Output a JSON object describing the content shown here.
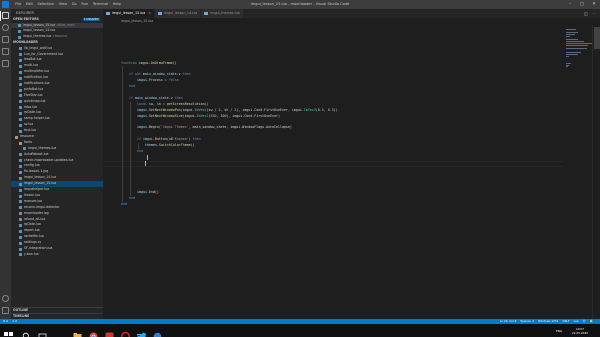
{
  "window": {
    "title": "imgui_lesson_15.lua - moonloader - Visual Studio Code",
    "menu": [
      "File",
      "Edit",
      "Selection",
      "View",
      "Go",
      "Run",
      "Terminal",
      "Help"
    ],
    "controls": [
      "–",
      "□",
      "✕"
    ]
  },
  "sidebar": {
    "title": "EXPLORER",
    "open_editors": {
      "label": "OPEN EDITORS",
      "badge": "1 UNSAVED",
      "items": [
        {
          "name": "imgui_lesson_15.lua",
          "extra": "other_mod",
          "color": "#519aba",
          "level": 1,
          "state": "selected"
        },
        {
          "name": "imgui_lesson_14.lua",
          "extra": "",
          "color": "#519aba",
          "level": 1,
          "state": ""
        },
        {
          "name": "imgui_themes.lua",
          "extra": "resource",
          "color": "#519aba",
          "level": 1,
          "state": ""
        }
      ]
    },
    "folder_label": "MOONLOADER",
    "files": [
      {
        "name": "lib_imgui_wolf.lua",
        "color": "#519aba",
        "level": 1
      },
      {
        "name": "Lua_for_Government.lua",
        "color": "#519aba",
        "level": 1
      },
      {
        "name": "lessBot.lua",
        "color": "#519aba",
        "level": 1
      },
      {
        "name": "multi.lua",
        "color": "#519aba",
        "level": 1
      },
      {
        "name": "multinotifier.lua",
        "color": "#519aba",
        "level": 1
      },
      {
        "name": "notification.lua",
        "color": "#519aba",
        "level": 1
      },
      {
        "name": "notifications.lua",
        "color": "#519aba",
        "level": 1
      },
      {
        "name": "pinfoBot.lua",
        "color": "#519aba",
        "level": 1
      },
      {
        "name": "FiveStar.lua",
        "color": "#519aba",
        "level": 1
      },
      {
        "name": "quickmap.lua",
        "color": "#519aba",
        "level": 1
      },
      {
        "name": "rkbo.lua",
        "color": "#519aba",
        "level": 1
      },
      {
        "name": "rpDate.lua",
        "color": "#519aba",
        "level": 1
      },
      {
        "name": "samp-helper.lua",
        "color": "#519aba",
        "level": 1
      },
      {
        "name": "sv.lua",
        "color": "#519aba",
        "level": 1
      },
      {
        "name": "test.lua",
        "color": "#519aba",
        "level": 1
      },
      {
        "name": "resource",
        "color": "#c09553",
        "level": 0
      },
      {
        "name": "fonts",
        "color": "#c09553",
        "level": 1
      },
      {
        "name": "imgui_themes.lua",
        "color": "#519aba",
        "level": 2
      },
      {
        "name": "AutoReboot.lua",
        "color": "#519aba",
        "level": 1
      },
      {
        "name": "check-moonloader-updates.lua",
        "color": "#519aba",
        "level": 1
      },
      {
        "name": "config.lua",
        "color": "#519aba",
        "level": 1
      },
      {
        "name": "fix-lesson-1.jpg",
        "color": "#a074c4",
        "level": 1
      },
      {
        "name": "imgui_lesson_14.lua",
        "color": "#519aba",
        "level": 1
      },
      {
        "name": "imgui_lesson_15.lua",
        "color": "#519aba",
        "level": 1,
        "state": "highlight"
      },
      {
        "name": "imputhelper.lua",
        "color": "#519aba",
        "level": 1
      },
      {
        "name": "lesson.lua",
        "color": "#519aba",
        "level": 1
      },
      {
        "name": "manuer.lua",
        "color": "#519aba",
        "level": 1
      },
      {
        "name": "reconn-imgui-detector",
        "color": "#519aba",
        "level": 1
      },
      {
        "name": "moonloader.log",
        "color": "#8a8a8a",
        "level": 1
      },
      {
        "name": "reload_all.lua",
        "color": "#519aba",
        "level": 1
      },
      {
        "name": "rpDate.lua",
        "color": "#519aba",
        "level": 1
      },
      {
        "name": "report.lua",
        "color": "#519aba",
        "level": 1
      },
      {
        "name": "rocketfix.lua",
        "color": "#519aba",
        "level": 1
      },
      {
        "name": "settings.cs",
        "color": "#519aba",
        "level": 1
      },
      {
        "name": "SF-integration.lua",
        "color": "#519aba",
        "level": 1
      },
      {
        "name": "y-box.lua",
        "color": "#519aba",
        "level": 1
      }
    ],
    "outline_label": "OUTLINE",
    "timeline_label": "TIMELINE"
  },
  "tabs": [
    {
      "label": "imgui_lesson_15.lua",
      "state": "active"
    },
    {
      "label": "imgui_lesson_14.lua",
      "state": ""
    },
    {
      "label": "imgui_themes.lua",
      "state": ""
    }
  ],
  "breadcrumb": "imgui_lesson_15.lua",
  "editor": {
    "lines": [
      {
        "row": 5,
        "indent": 0,
        "tokens": [
          [
            "kw",
            "function "
          ],
          [
            "fn",
            "imgui.OnDrawFrame"
          ],
          [
            "p",
            "()"
          ]
        ]
      },
      {
        "row": 7,
        "indent": 1,
        "tokens": [
          [
            "kw",
            "if not "
          ],
          [
            "var",
            "main_window_state"
          ],
          [
            "p",
            ".v "
          ],
          [
            "kw",
            "then"
          ]
        ]
      },
      {
        "row": 8,
        "indent": 2,
        "tokens": [
          [
            "var",
            "imgui"
          ],
          [
            "p",
            ".Process = "
          ],
          [
            "kw",
            "false"
          ]
        ]
      },
      {
        "row": 9,
        "indent": 1,
        "tokens": [
          [
            "kw",
            "end"
          ]
        ]
      },
      {
        "row": 11,
        "indent": 1,
        "tokens": [
          [
            "kw",
            "if "
          ],
          [
            "var",
            "main_window_state"
          ],
          [
            "p",
            ".v "
          ],
          [
            "kw",
            "then"
          ]
        ]
      },
      {
        "row": 12,
        "indent": 2,
        "tokens": [
          [
            "kw",
            "local "
          ],
          [
            "var",
            "sw"
          ],
          [
            "p",
            ", "
          ],
          [
            "var",
            "sh"
          ],
          [
            "p",
            " = "
          ],
          [
            "fn",
            "getScreenResolution"
          ],
          [
            "p",
            "()"
          ]
        ]
      },
      {
        "row": 13,
        "indent": 2,
        "tokens": [
          [
            "var",
            "imgui"
          ],
          [
            "p",
            "."
          ],
          [
            "fn",
            "SetNextWindowPos"
          ],
          [
            "p",
            "(imgui."
          ],
          [
            "cls",
            "ImVec2"
          ],
          [
            "p",
            "(sw / "
          ],
          [
            "num",
            "2"
          ],
          [
            "p",
            ", sh / "
          ],
          [
            "num",
            "2"
          ],
          [
            "p",
            "), imgui.Cond.FirstUseEver, imgui."
          ],
          [
            "cls",
            "ImVec2"
          ],
          [
            "p",
            "("
          ],
          [
            "num",
            "0.5"
          ],
          [
            "p",
            ", "
          ],
          [
            "num",
            "0.5"
          ],
          [
            "p",
            "))"
          ]
        ]
      },
      {
        "row": 14,
        "indent": 2,
        "tokens": [
          [
            "var",
            "imgui"
          ],
          [
            "p",
            "."
          ],
          [
            "fn",
            "SetNextWindowSize"
          ],
          [
            "p",
            "(imgui."
          ],
          [
            "cls",
            "ImVec2"
          ],
          [
            "p",
            "("
          ],
          [
            "num",
            "530"
          ],
          [
            "p",
            ", "
          ],
          [
            "num",
            "300"
          ],
          [
            "p",
            "), imgui.Cond.FirstUseEver)"
          ]
        ]
      },
      {
        "row": 16,
        "indent": 2,
        "tokens": [
          [
            "var",
            "imgui"
          ],
          [
            "p",
            "."
          ],
          [
            "fn",
            "Begin"
          ],
          [
            "p",
            "("
          ],
          [
            "str",
            "'Imgui Themes'"
          ],
          [
            "p",
            ", main_window_state, imgui.WindowFlags.AutoCollapse)"
          ]
        ]
      },
      {
        "row": 18,
        "indent": 2,
        "tokens": [
          [
            "kw",
            "if "
          ],
          [
            "var",
            "imgui"
          ],
          [
            "p",
            "."
          ],
          [
            "fn",
            "Button"
          ],
          [
            "p",
            "(u8"
          ],
          [
            "str",
            "'Кнопка'"
          ],
          [
            "p",
            ") "
          ],
          [
            "kw",
            "then"
          ]
        ]
      },
      {
        "row": 19,
        "indent": 3,
        "tokens": [
          [
            "var",
            "themes"
          ],
          [
            "p",
            "."
          ],
          [
            "fn",
            "SwitchColorTheme"
          ],
          [
            "p",
            "()"
          ]
        ]
      },
      {
        "row": 20,
        "indent": 2,
        "tokens": [
          [
            "kw",
            "end"
          ]
        ]
      },
      {
        "row": 27,
        "indent": 2,
        "tokens": [
          [
            "var",
            "imgui"
          ],
          [
            "p",
            "."
          ],
          [
            "fn",
            "End"
          ],
          [
            "p",
            "()"
          ]
        ]
      },
      {
        "row": 28,
        "indent": 1,
        "tokens": [
          [
            "kw",
            "end"
          ]
        ]
      },
      {
        "row": 29,
        "indent": 0,
        "tokens": [
          [
            "kw",
            "end"
          ]
        ]
      }
    ]
  },
  "statusbar": {
    "left": [
      "⊗ 0",
      "⚠ 0"
    ],
    "right": [
      "Ln 22, Col 9",
      "Spaces: 4",
      "Windows 1251",
      "CRLF",
      "Lua",
      "☺",
      "🔔"
    ]
  },
  "taskbar": {
    "time": "19:07",
    "date": "22.05.2020",
    "lang": "ENG"
  }
}
